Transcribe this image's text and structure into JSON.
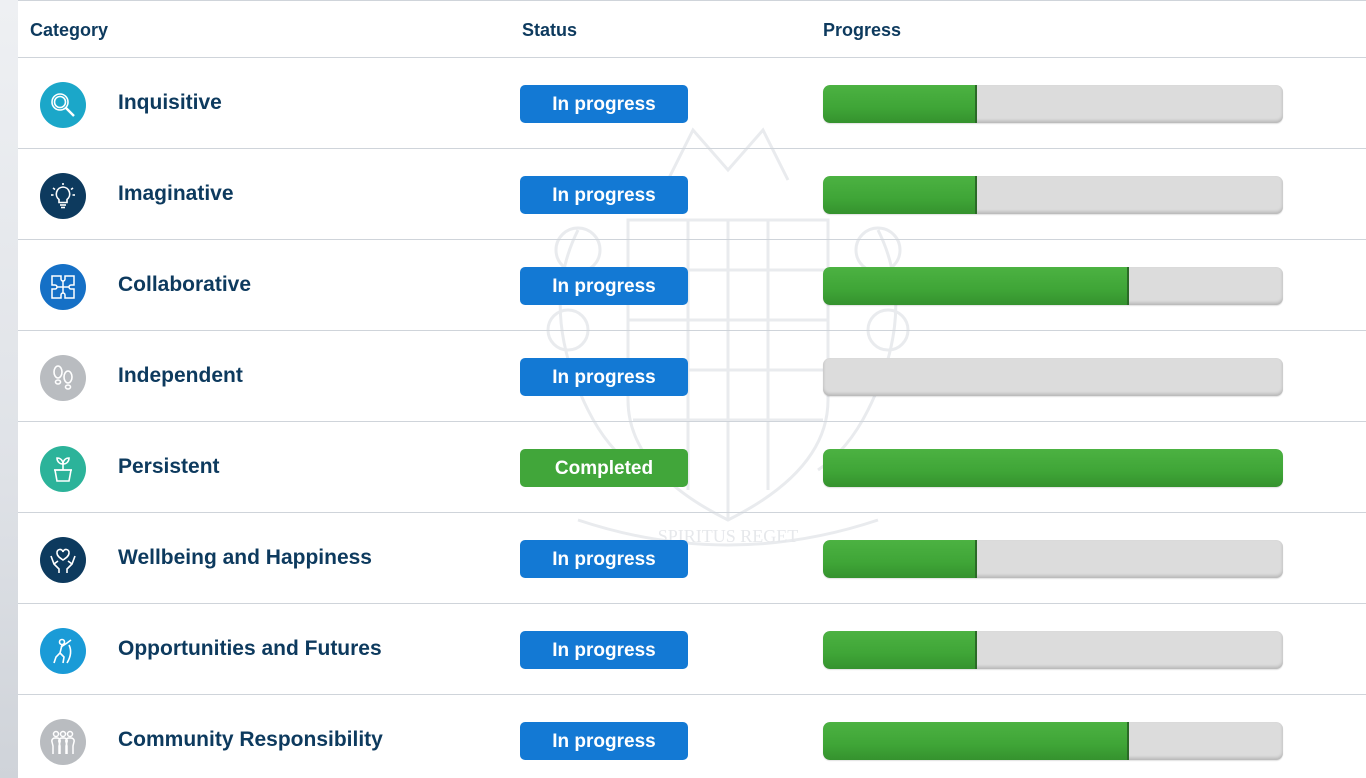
{
  "header": {
    "category": "Category",
    "status": "Status",
    "progress": "Progress"
  },
  "watermark": {
    "motto": "SPIRITUS REGET"
  },
  "rows": [
    {
      "label": "Inquisitive",
      "icon": "magnifier-icon",
      "icon_color": "#1ba7c9",
      "status": "In progress",
      "status_type": "progress",
      "progress": 0.33
    },
    {
      "label": "Imaginative",
      "icon": "lightbulb-icon",
      "icon_color": "#0d3a5e",
      "status": "In progress",
      "status_type": "progress",
      "progress": 0.33
    },
    {
      "label": "Collaborative",
      "icon": "puzzle-icon",
      "icon_color": "#1570c6",
      "status": "In progress",
      "status_type": "progress",
      "progress": 0.66
    },
    {
      "label": "Independent",
      "icon": "footprints-icon",
      "icon_color": "#b9bcc0",
      "status": "In progress",
      "status_type": "progress",
      "progress": 0.0
    },
    {
      "label": "Persistent",
      "icon": "plant-pot-icon",
      "icon_color": "#2cb39a",
      "status": "Completed",
      "status_type": "completed",
      "progress": 1.0
    },
    {
      "label": "Wellbeing and Happiness",
      "icon": "heart-hands-icon",
      "icon_color": "#0d3a5e",
      "status": "In progress",
      "status_type": "progress",
      "progress": 0.33
    },
    {
      "label": "Opportunities and Futures",
      "icon": "climber-icon",
      "icon_color": "#1a9bd7",
      "status": "In progress",
      "status_type": "progress",
      "progress": 0.33
    },
    {
      "label": "Community Responsibility",
      "icon": "people-group-icon",
      "icon_color": "#b9bcc0",
      "status": "In progress",
      "status_type": "progress",
      "progress": 0.66
    }
  ]
}
